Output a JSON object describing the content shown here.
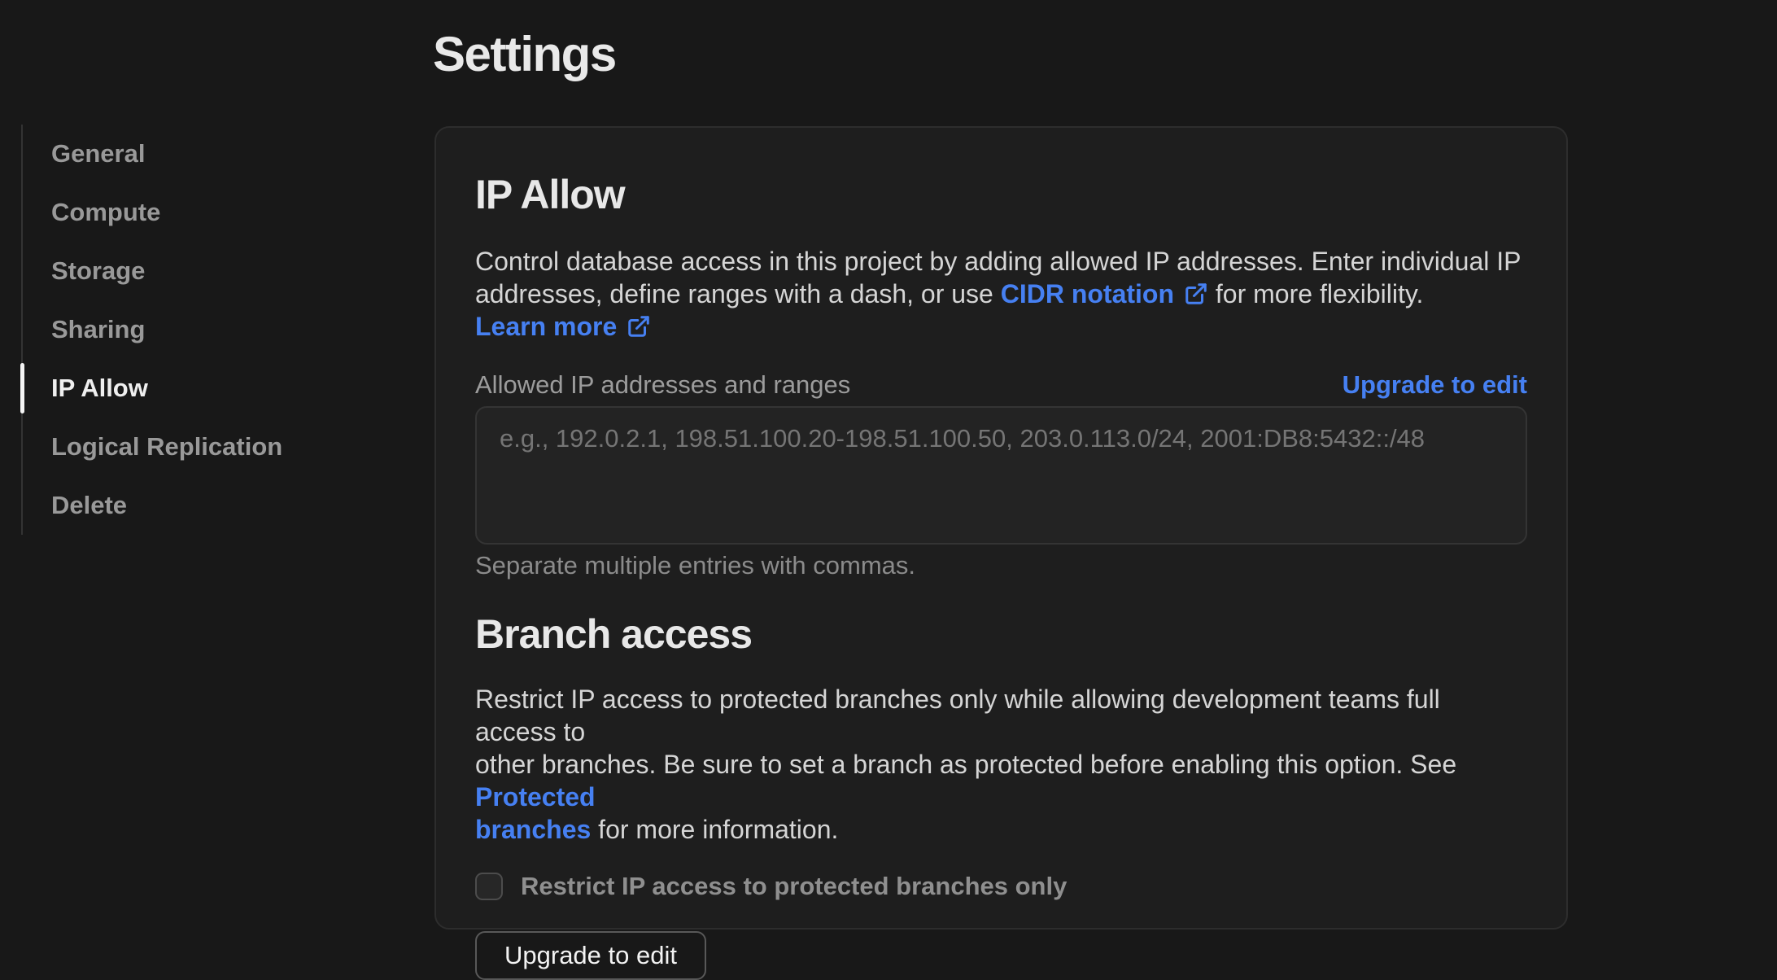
{
  "page": {
    "title": "Settings"
  },
  "sidebar": {
    "items": [
      {
        "label": "General",
        "active": false
      },
      {
        "label": "Compute",
        "active": false
      },
      {
        "label": "Storage",
        "active": false
      },
      {
        "label": "Sharing",
        "active": false
      },
      {
        "label": "IP Allow",
        "active": true
      },
      {
        "label": "Logical Replication",
        "active": false
      },
      {
        "label": "Delete",
        "active": false
      }
    ]
  },
  "ip_allow": {
    "heading": "IP Allow",
    "desc_line1": "Control database access in this project by adding allowed IP addresses. Enter individual IP",
    "desc_line2_pre": "addresses, define ranges with a dash, or use ",
    "cidr_link_label": "CIDR notation",
    "desc_line2_mid": " for more flexibility. ",
    "learn_more_label": "Learn more",
    "field_label": "Allowed IP addresses and ranges",
    "upgrade_link_label": "Upgrade to edit",
    "textarea_placeholder": "e.g., 192.0.2.1, 198.51.100.20-198.51.100.50, 203.0.113.0/24, 2001:DB8:5432::/48",
    "helper": "Separate multiple entries with commas."
  },
  "branch_access": {
    "heading": "Branch access",
    "desc_line1": "Restrict IP access to protected branches only while allowing development teams full access to",
    "desc_line2_pre": "other branches. Be sure to set a branch as protected before enabling this option. See ",
    "protected_link_part1": "Protected",
    "protected_link_part2": "branches",
    "desc_line3_post": " for more information.",
    "checkbox_label": "Restrict IP access to protected branches only",
    "upgrade_button_label": "Upgrade to edit"
  },
  "colors": {
    "page_bg": "#181818",
    "card_bg": "#1e1e1e",
    "card_border": "#2d2d2d",
    "link_blue": "#4680f2",
    "active_indicator": "#f4f4f4"
  },
  "icons": {
    "external_link": "external-link-icon"
  }
}
